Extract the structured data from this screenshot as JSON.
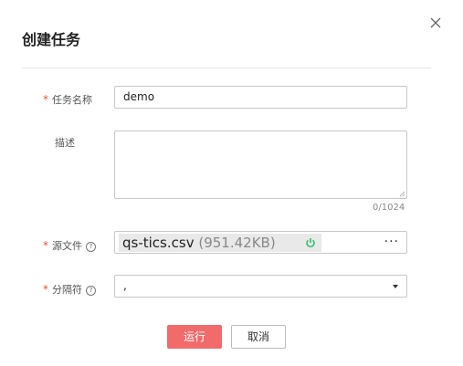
{
  "dialog": {
    "title": "创建任务",
    "close_icon": "close-icon"
  },
  "form": {
    "task_name": {
      "label": "任务名称",
      "value": "demo",
      "required_mark": "*"
    },
    "description": {
      "label": "描述",
      "value": "",
      "counter": "0/1024"
    },
    "source_file": {
      "label": "源文件",
      "required_mark": "*",
      "help_icon": "help-circle-icon",
      "file_name": "qs-tics.csv",
      "file_size": "(951.42KB)",
      "status_icon": "power-icon",
      "status_color": "#2bbf6a",
      "more_label": "···"
    },
    "delimiter": {
      "label": "分隔符",
      "required_mark": "*",
      "help_icon": "help-circle-icon",
      "value": ","
    }
  },
  "actions": {
    "run_label": "运行",
    "cancel_label": "取消"
  },
  "colors": {
    "required": "#e8553b",
    "primary_button": "#f16b6b"
  }
}
